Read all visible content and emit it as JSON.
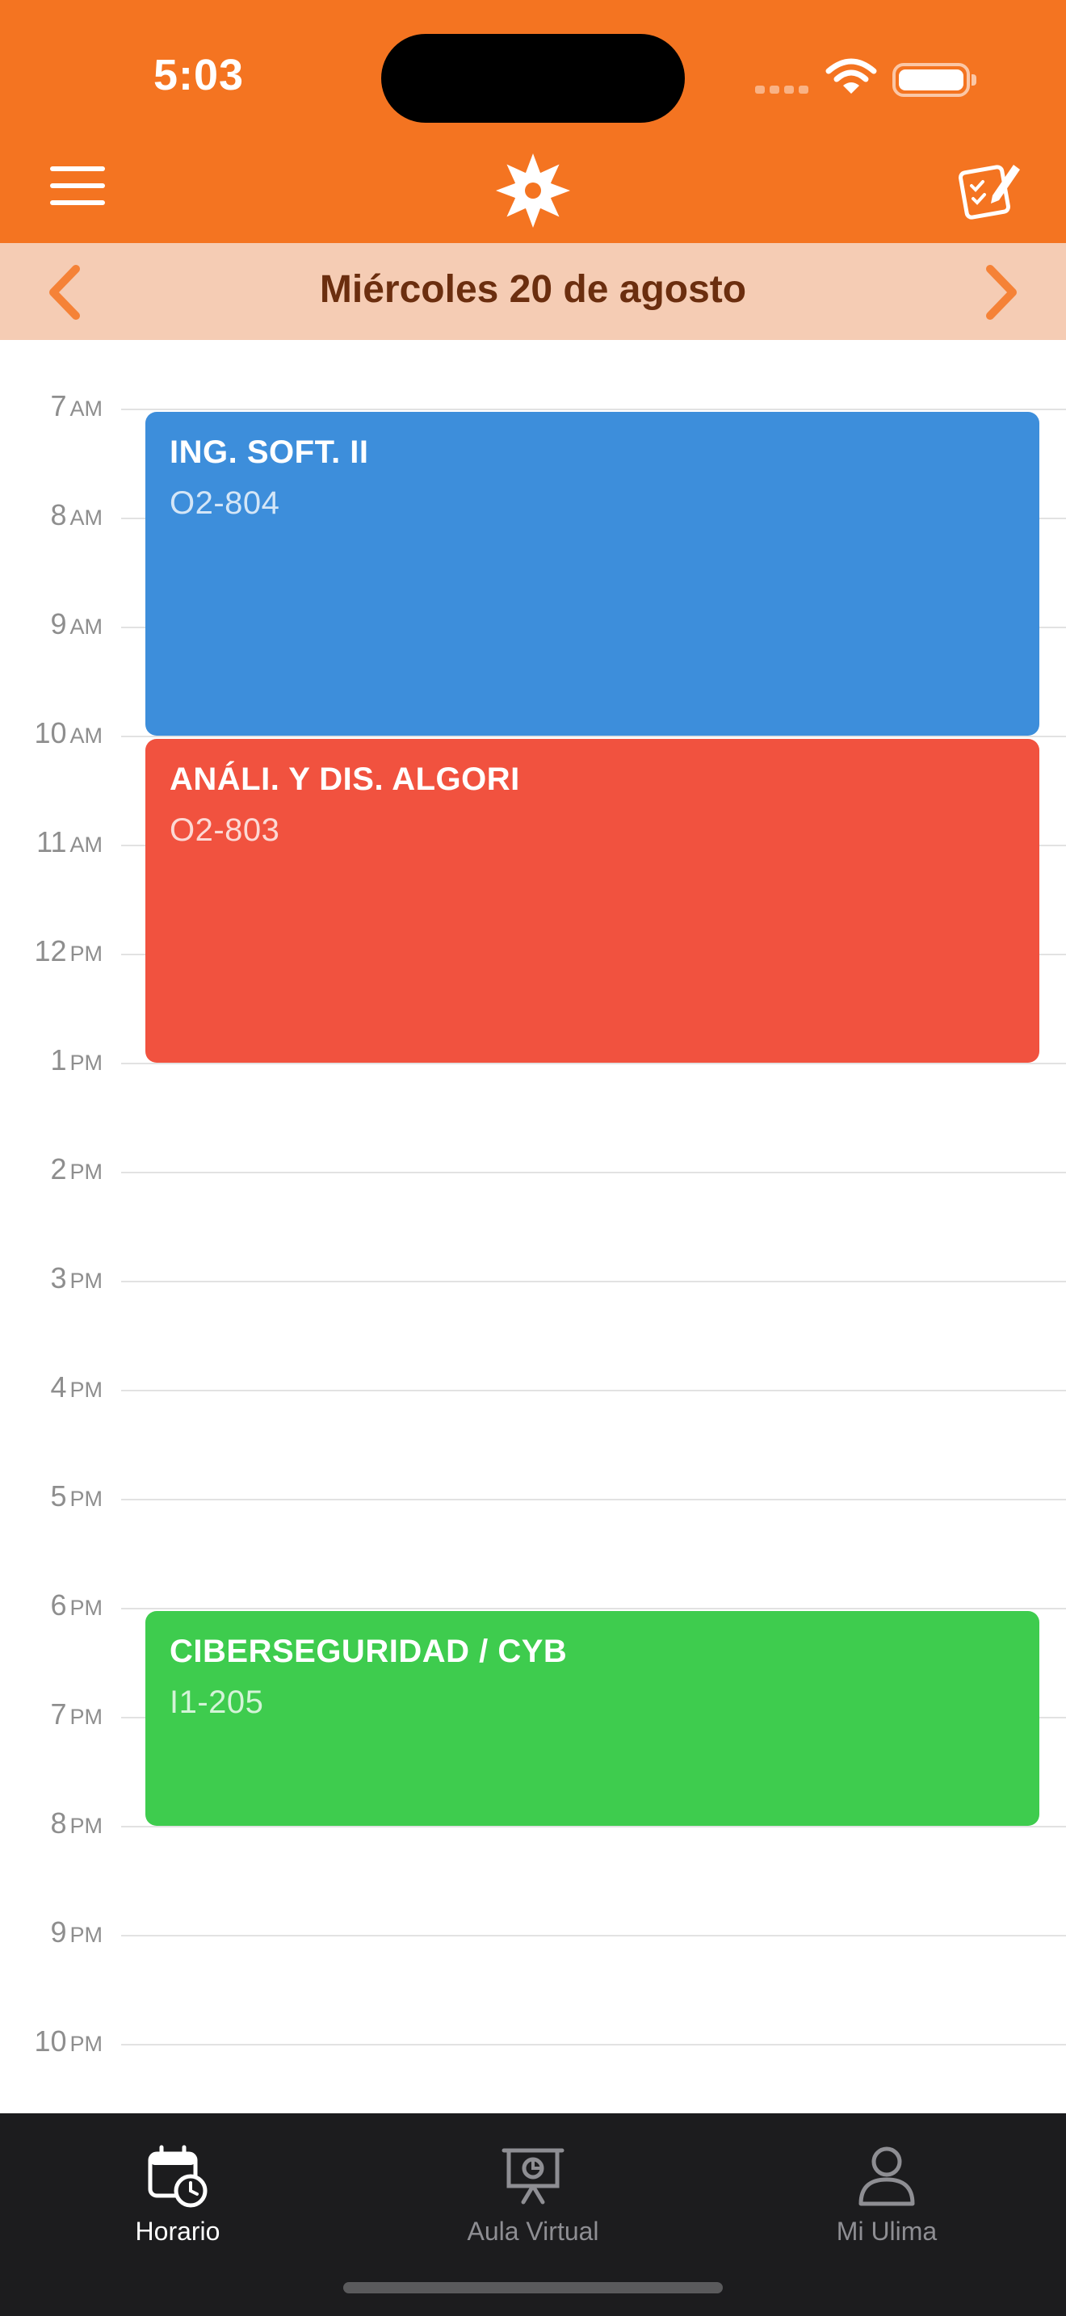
{
  "status": {
    "time": "5:03"
  },
  "header": {
    "date": "Miércoles 20 de agosto"
  },
  "hours": [
    {
      "num": "7",
      "ampm": "AM"
    },
    {
      "num": "8",
      "ampm": "AM"
    },
    {
      "num": "9",
      "ampm": "AM"
    },
    {
      "num": "10",
      "ampm": "AM"
    },
    {
      "num": "11",
      "ampm": "AM"
    },
    {
      "num": "12",
      "ampm": "PM"
    },
    {
      "num": "1",
      "ampm": "PM"
    },
    {
      "num": "2",
      "ampm": "PM"
    },
    {
      "num": "3",
      "ampm": "PM"
    },
    {
      "num": "4",
      "ampm": "PM"
    },
    {
      "num": "5",
      "ampm": "PM"
    },
    {
      "num": "6",
      "ampm": "PM"
    },
    {
      "num": "7",
      "ampm": "PM"
    },
    {
      "num": "8",
      "ampm": "PM"
    },
    {
      "num": "9",
      "ampm": "PM"
    },
    {
      "num": "10",
      "ampm": "PM"
    }
  ],
  "events": [
    {
      "title": "ING. SOFT. II",
      "room": "O2-804",
      "color": "#3d8edb"
    },
    {
      "title": "ANÁLI. Y DIS. ALGORI",
      "room": "O2-803",
      "color": "#f1523f"
    },
    {
      "title": "CIBERSEGURIDAD / CYB",
      "room": "I1-205",
      "color": "#3ecc4e"
    }
  ],
  "tabs": [
    {
      "label": "Horario",
      "icon": "calendar-clock-icon",
      "active": true
    },
    {
      "label": "Aula Virtual",
      "icon": "presentation-board-icon",
      "active": false
    },
    {
      "label": "Mi Ulima",
      "icon": "person-icon",
      "active": false
    }
  ],
  "colors": {
    "brand": "#f47421",
    "date_bar": "#f5ccb4",
    "date_text": "#6b2e0f",
    "tab_bar": "#1c1c1e"
  }
}
